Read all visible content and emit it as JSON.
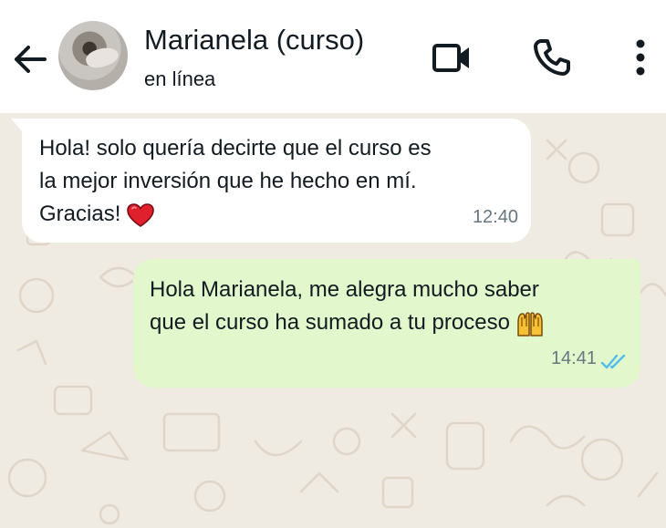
{
  "header": {
    "contact_name": "Marianela (curso)",
    "status": "en línea",
    "icons": {
      "back": "arrow-left-icon",
      "video": "video-camera-icon",
      "call": "phone-icon",
      "menu": "more-vertical-icon"
    }
  },
  "messages": [
    {
      "direction": "incoming",
      "lines": [
        "Hola! solo quería decirte que el curso es",
        "la mejor inversión que he hecho en mí.",
        "Gracias!"
      ],
      "emoji": "red-heart",
      "time": "12:40"
    },
    {
      "direction": "outgoing",
      "lines": [
        "Hola Marianela, me alegra mucho saber",
        "que el curso ha sumado a tu proceso"
      ],
      "emoji": "raising-hands",
      "time": "14:41",
      "status": "read-double-check"
    }
  ],
  "colors": {
    "chat_background": "#efeae2",
    "incoming_bubble": "#ffffff",
    "outgoing_bubble": "#e2f7cb",
    "read_ticks": "#53bdeb",
    "time_text": "#667781"
  }
}
